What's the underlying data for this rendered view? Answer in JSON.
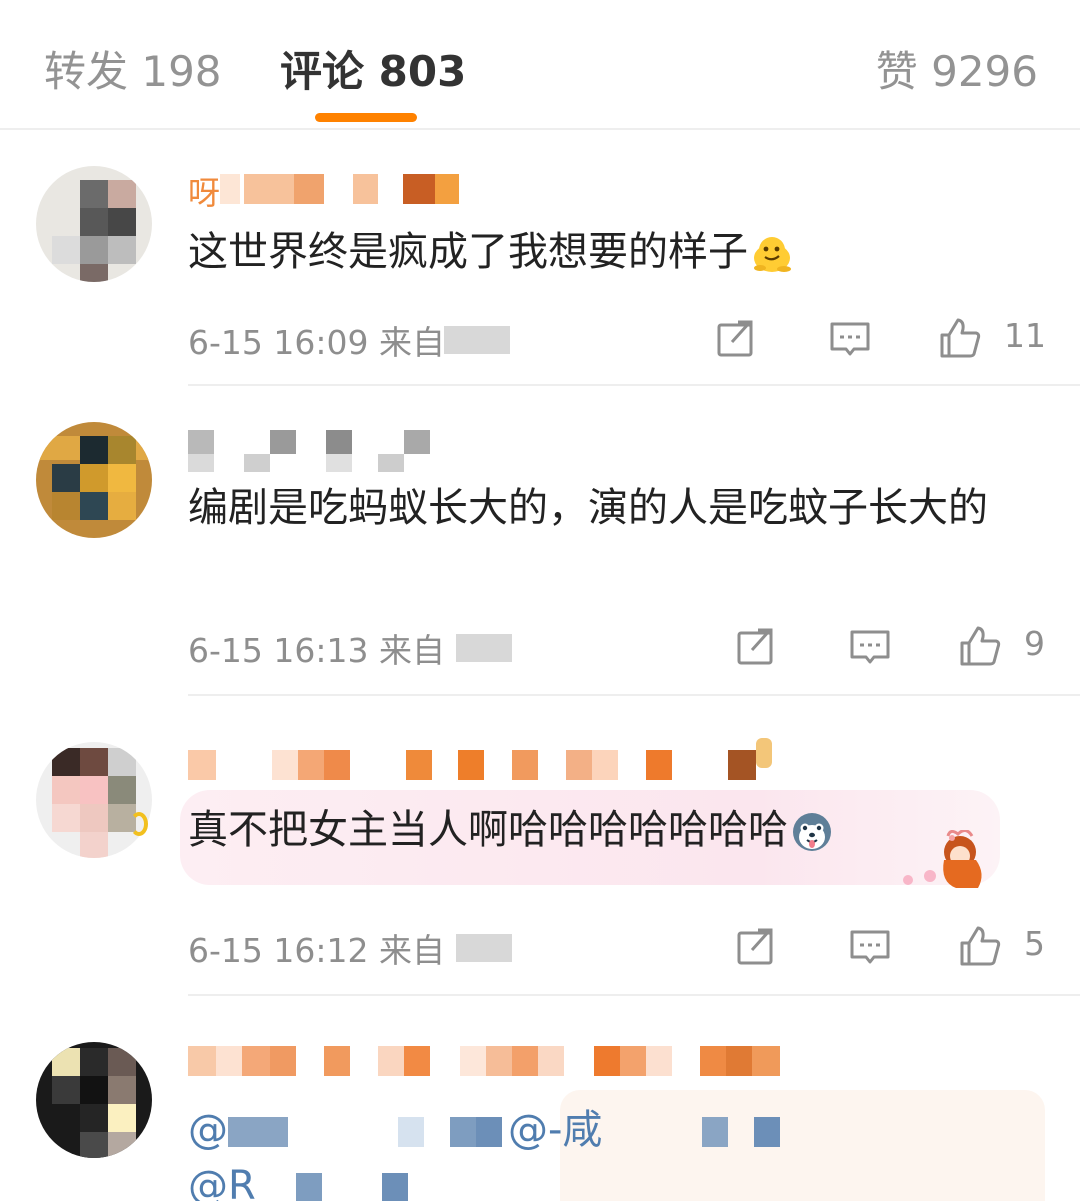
{
  "tabs": {
    "repost": "转发 198",
    "comments": "评论 803",
    "likes": "赞 9296"
  },
  "comments": [
    {
      "name_visible": "呀",
      "text": "这世界终是疯成了我想要的样子",
      "emoji": "melting-face-emoji",
      "time": "6-15 16:09",
      "source_label": "来自",
      "likes": "11"
    },
    {
      "name_visible": "",
      "text": "编剧是吃蚂蚁长大的，演的人是吃蚊子长大的",
      "emoji": "",
      "time": "6-15 16:13",
      "source_label": "来自",
      "likes": "9"
    },
    {
      "name_visible": "",
      "text": "真不把女主当人啊哈哈哈哈哈哈哈",
      "emoji": "husky-emoji",
      "time": "6-15 16:12",
      "source_label": "来自",
      "likes": "5"
    },
    {
      "name_visible": "",
      "text_parts": [
        "@",
        "@-咸",
        "@R"
      ],
      "emoji": "",
      "time": "",
      "source_label": "",
      "likes": ""
    }
  ],
  "icons": {
    "repost": "share-icon",
    "comment": "comment-icon",
    "like": "thumbs-up-icon"
  },
  "colors": {
    "tab_active_underline": "#ff8200",
    "mention": "#507daf",
    "meta_gray": "#8e8e8e"
  }
}
